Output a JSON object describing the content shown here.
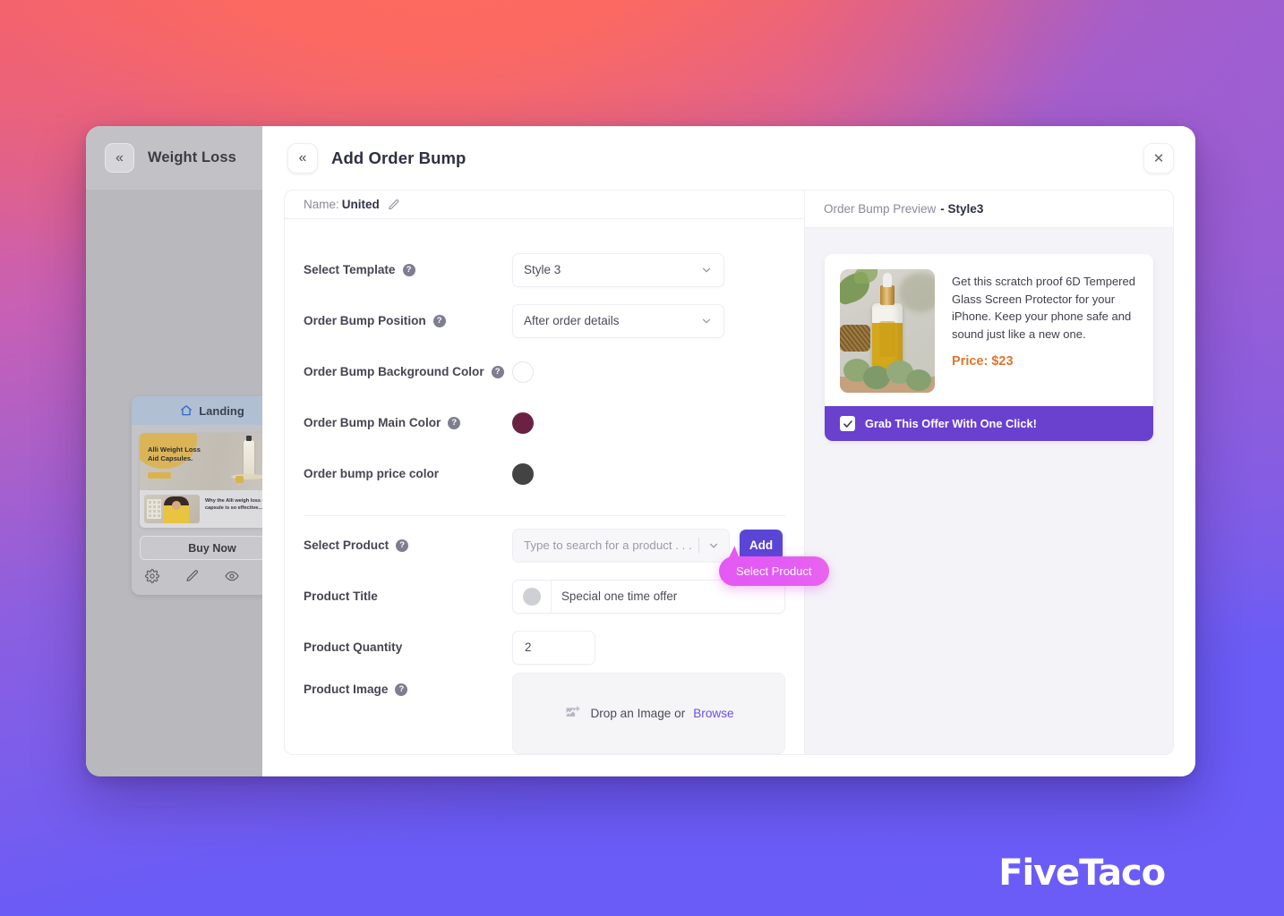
{
  "app": {
    "sidebar_title": "Weight Loss",
    "collapse_icon": "chevron-double-left-icon",
    "funnel_card": {
      "step_label": "Landing",
      "home_icon": "home-icon",
      "hero_heading": "Alli Weight Loss Aid Capsules.",
      "section_text": "Why the Alli weigh loss aid capsule is so effective...",
      "buy_button": "Buy Now",
      "actions": [
        "gear-icon",
        "pencil-icon",
        "eye-icon",
        "copy-icon"
      ]
    }
  },
  "modal": {
    "back_icon": "chevron-double-left-icon",
    "title": "Add Order Bump",
    "close_icon": "close-icon",
    "name_bar": {
      "label": "Name:",
      "value": "United",
      "edit_icon": "pencil-icon"
    },
    "preview_bar": {
      "label": "Order Bump Preview",
      "separator": "- ",
      "style": "Style3"
    }
  },
  "form": {
    "help_icon": "question-mark-icon",
    "chevron_icon": "chevron-down-icon",
    "fields": {
      "template": {
        "label": "Select Template",
        "value": "Style 3",
        "has_help": true
      },
      "position": {
        "label": "Order Bump Position",
        "value": "After order details",
        "has_help": true
      },
      "background_color": {
        "label": "Order Bump Background Color",
        "value": "#ffffff",
        "has_help": true
      },
      "main_color": {
        "label": "Order Bump Main Color",
        "value": "#6b2142",
        "has_help": true
      },
      "price_color": {
        "label": "Order bump price color",
        "value": "#434343",
        "has_help": false
      },
      "select_product": {
        "label": "Select Product",
        "placeholder": "Type to search for a product . . .",
        "value": "",
        "add_button": "Add",
        "has_help": true
      },
      "product_title": {
        "label": "Product Title",
        "value": "Special one time offer",
        "has_help": false
      },
      "product_quantity": {
        "label": "Product Quantity",
        "value": "2",
        "has_help": false
      },
      "product_image": {
        "label": "Product Image",
        "drop_text": "Drop an Image or",
        "browse_text": "Browse",
        "image_icon": "image-add-icon",
        "has_help": true
      }
    }
  },
  "tooltip": {
    "text": "Select Product",
    "color": "#e459f2"
  },
  "preview": {
    "description": "Get this scratch proof 6D Tempered Glass Screen Protector for your iPhone. Keep your phone safe and sound just like a new one.",
    "price_label": "Price: $23",
    "cta_text": "Grab This Offer With One Click!",
    "cta_checked": true,
    "cta_color": "#6a40cf",
    "price_color": "#e0762e",
    "check_icon": "check-icon",
    "product_image_alt": "serum-bottle-photo"
  },
  "branding": {
    "watermark": "FiveTaco"
  },
  "colors": {
    "accent_purple": "#5b45d6",
    "cta_purple": "#6a40cf",
    "tooltip_magenta": "#e459f2",
    "price_orange": "#e0762e",
    "bg_gradient_start": "#fd6a5e",
    "bg_gradient_end": "#6a5cf6"
  }
}
